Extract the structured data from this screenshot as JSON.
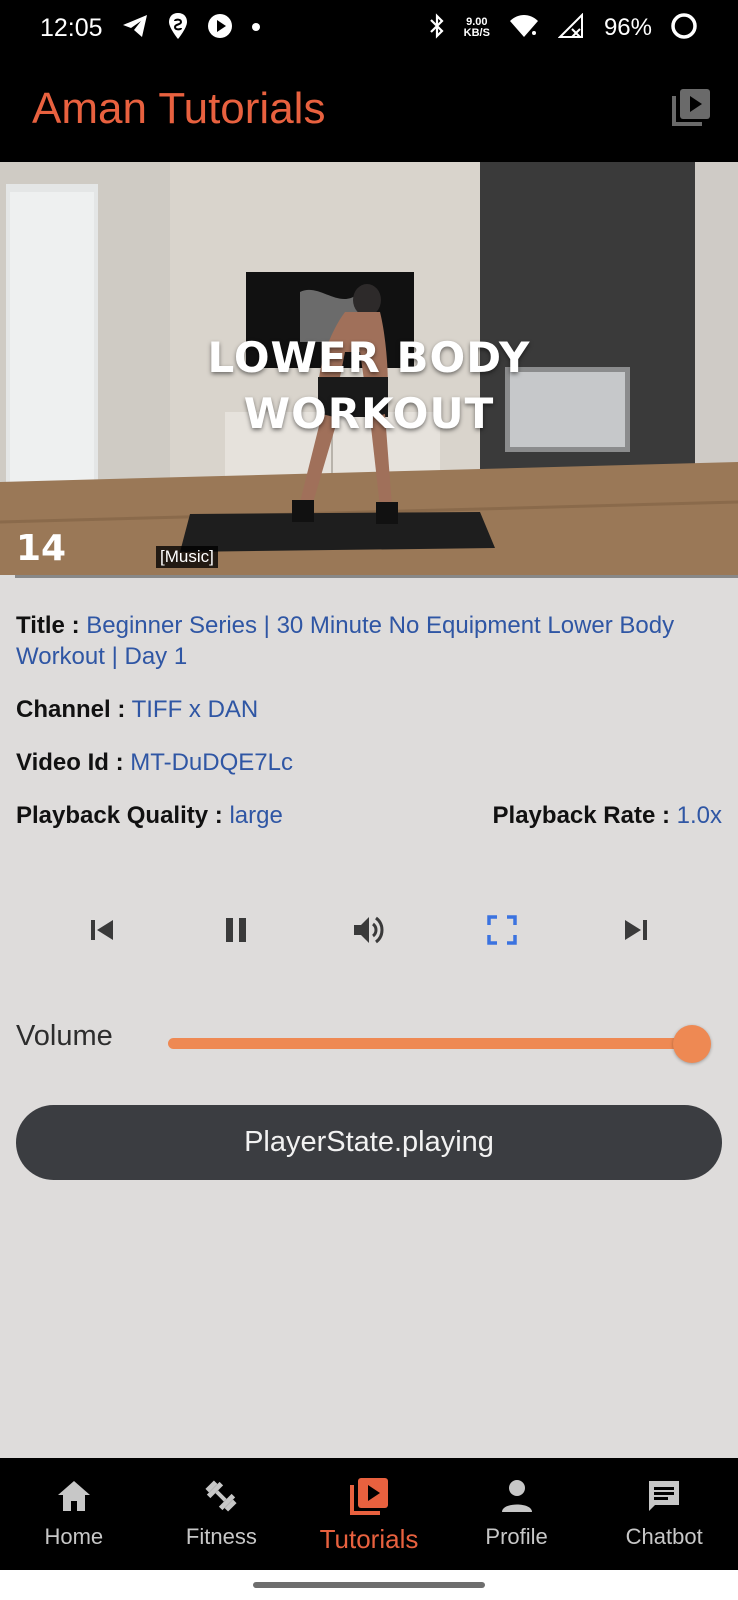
{
  "status": {
    "time": "12:05",
    "speed_value": "9.00",
    "speed_unit": "KB/S",
    "battery": "96%"
  },
  "app_bar": {
    "title": "Aman Tutorials",
    "action_icon": "video-library-icon"
  },
  "video": {
    "overlay_title_line1": "LOWER BODY",
    "overlay_title_line2": "WORKOUT",
    "counter": "14",
    "caption": "[Music]",
    "progress": 0.02
  },
  "info": {
    "title_label": "Title :",
    "title_value": "Beginner Series | 30 Minute No Equipment Lower Body Workout | Day 1",
    "channel_label": "Channel :",
    "channel_value": "TIFF x DAN",
    "video_id_label": "Video Id :",
    "video_id_value": "MT-DuDQE7Lc",
    "quality_label": "Playback Quality :",
    "quality_value": "large",
    "rate_label": "Playback Rate :",
    "rate_value": "1.0x"
  },
  "controls": [
    "skip-previous-icon",
    "pause-icon",
    "volume-up-icon",
    "fullscreen-icon",
    "skip-next-icon"
  ],
  "volume": {
    "label": "Volume",
    "level": 1.0,
    "accent": "#ee8953"
  },
  "player_state": "PlayerState.playing",
  "nav": [
    {
      "label": "Home",
      "icon": "home-icon",
      "active": false
    },
    {
      "label": "Fitness",
      "icon": "fitness-icon",
      "active": false
    },
    {
      "label": "Tutorials",
      "icon": "video-library-icon",
      "active": true
    },
    {
      "label": "Profile",
      "icon": "person-icon",
      "active": false
    },
    {
      "label": "Chatbot",
      "icon": "chat-icon",
      "active": false
    }
  ],
  "colors": {
    "accent": "#e8613f",
    "link": "#2f56a4",
    "fullscreen_icon": "#3b73e0"
  }
}
